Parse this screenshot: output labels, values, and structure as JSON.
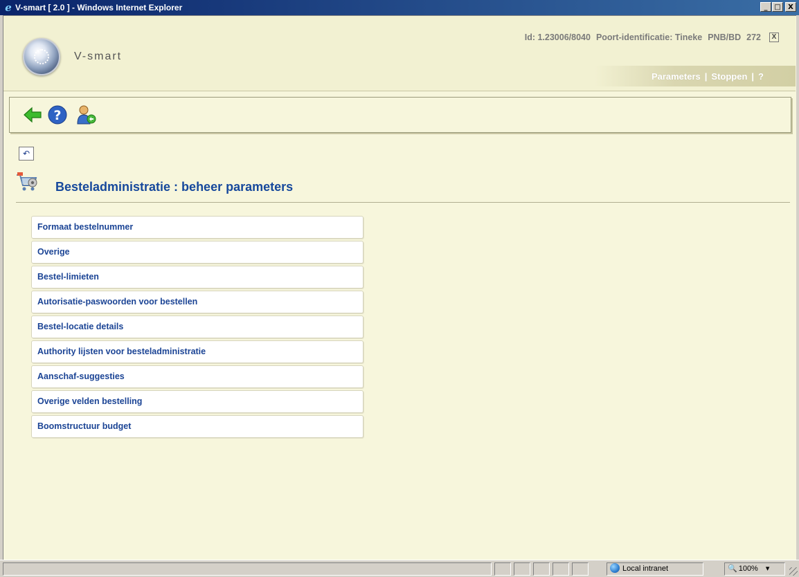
{
  "window": {
    "title": "V-smart [ 2.0 ] - Windows Internet Explorer",
    "min_label": "_",
    "max_label": "□",
    "close_label": "X"
  },
  "header": {
    "brand": "V-smart",
    "id_text": "Id: 1.23006/8040",
    "port_text": "Poort-identificatie: Tineke",
    "location_text": "PNB/BD",
    "count_text": "272",
    "close_label": "X",
    "links": {
      "parameters": "Parameters",
      "stoppen": "Stoppen",
      "help": "?",
      "separator": "|"
    }
  },
  "toolbar": {
    "icons": [
      "back-arrow-icon",
      "help-icon",
      "user-switch-icon"
    ]
  },
  "undo_icon_glyph": "↶",
  "page": {
    "title": "Besteladministratie : beheer parameters"
  },
  "menu": {
    "items": [
      "Formaat bestelnummer",
      "Overige",
      "Bestel-limieten",
      "Autorisatie-paswoorden voor bestellen",
      "Bestel-locatie details",
      "Authority lijsten voor besteladministratie",
      "Aanschaf-suggesties",
      "Overige velden bestelling",
      "Boomstructuur budget"
    ]
  },
  "statusbar": {
    "zone": "Local intranet",
    "zoom": "100%",
    "zoom_dropdown": "▾"
  },
  "colors": {
    "accent": "#16489c",
    "background": "#f7f6dc"
  }
}
